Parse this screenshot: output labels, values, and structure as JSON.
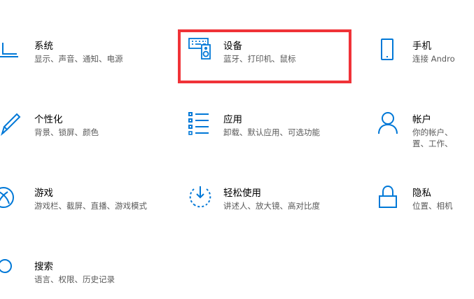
{
  "accent_color": "#0078d7",
  "highlight_color": "#f03338",
  "tiles": {
    "system": {
      "title": "系统",
      "desc": "显示、声音、通知、电源",
      "icon": "laptop-icon"
    },
    "devices": {
      "title": "设备",
      "desc": "蓝牙、打印机、鼠标",
      "icon": "keyboard-speaker-icon"
    },
    "phone": {
      "title": "手机",
      "desc": "连接 Andro",
      "icon": "phone-icon"
    },
    "personalization": {
      "title": "个性化",
      "desc": "背景、锁屏、颜色",
      "icon": "pen-icon"
    },
    "apps": {
      "title": "应用",
      "desc": "卸载、默认应用、可选功能",
      "icon": "app-list-icon"
    },
    "accounts": {
      "title": "帐户",
      "desc_line1": "你的帐户、",
      "desc_line2": "置、工作、",
      "icon": "person-icon"
    },
    "gaming": {
      "title": "游戏",
      "desc": "游戏栏、截屏、直播、游戏模式",
      "icon": "xbox-icon"
    },
    "ease": {
      "title": "轻松使用",
      "desc": "讲述人、放大镜、高对比度",
      "icon": "ease-of-access-icon"
    },
    "privacy": {
      "title": "隐私",
      "desc": "位置、相机",
      "icon": "lock-icon"
    },
    "search": {
      "title": "搜索",
      "desc": "语言、权限、历史记录",
      "icon": "search-icon"
    }
  }
}
